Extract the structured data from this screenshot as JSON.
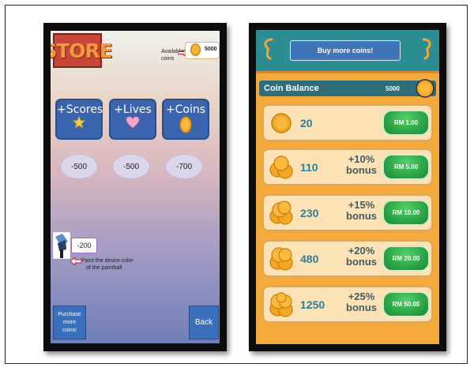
{
  "left_screen": {
    "store_title": "STORE",
    "available_label_line1": "Available",
    "available_label_line2": "coins",
    "available_value": "5000",
    "items": [
      {
        "label": "+Scores",
        "icon": "star-icon",
        "price": "-500"
      },
      {
        "label": "+Lives",
        "icon": "heart-icon",
        "price": "-500"
      },
      {
        "label": "+Coins",
        "icon": "coin-icon",
        "price": "-700"
      }
    ],
    "paintball_price": "-200",
    "paintball_note_line1": "Paint the desire color",
    "paintball_note_line2": "of the paintball",
    "purchase_more_label": "Purchase more coins!",
    "back_label": "Back"
  },
  "right_screen": {
    "buy_more_label": "Buy more coins!",
    "balance_label": "Coin Balance",
    "balance_value": "5000",
    "packages": [
      {
        "amount": "20",
        "bonus_pct": "",
        "bonus_word": "",
        "price": "RM 1.00"
      },
      {
        "amount": "110",
        "bonus_pct": "+10%",
        "bonus_word": "bonus",
        "price": "RM 5.00"
      },
      {
        "amount": "230",
        "bonus_pct": "+15%",
        "bonus_word": "bonus",
        "price": "RM 10.00"
      },
      {
        "amount": "480",
        "bonus_pct": "+20%",
        "bonus_word": "bonus",
        "price": "RM 20.00"
      },
      {
        "amount": "1250",
        "bonus_pct": "+25%",
        "bonus_word": "bonus",
        "price": "RM 50.00"
      }
    ]
  },
  "colors": {
    "coin_gold": "#f5a623",
    "store_red": "#c8453a",
    "button_blue": "#3a65ae",
    "header_teal": "#2c8d93",
    "buy_green": "#2ca447",
    "amount_teal": "#2d7f96"
  }
}
